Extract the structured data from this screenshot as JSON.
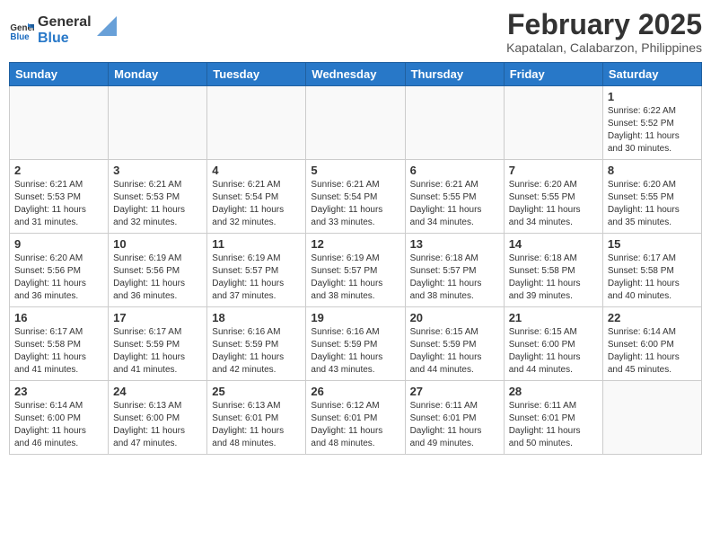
{
  "header": {
    "logo_line1": "General",
    "logo_line2": "Blue",
    "month_year": "February 2025",
    "location": "Kapatalan, Calabarzon, Philippines"
  },
  "weekdays": [
    "Sunday",
    "Monday",
    "Tuesday",
    "Wednesday",
    "Thursday",
    "Friday",
    "Saturday"
  ],
  "weeks": [
    [
      {
        "day": "",
        "info": ""
      },
      {
        "day": "",
        "info": ""
      },
      {
        "day": "",
        "info": ""
      },
      {
        "day": "",
        "info": ""
      },
      {
        "day": "",
        "info": ""
      },
      {
        "day": "",
        "info": ""
      },
      {
        "day": "1",
        "info": "Sunrise: 6:22 AM\nSunset: 5:52 PM\nDaylight: 11 hours\nand 30 minutes."
      }
    ],
    [
      {
        "day": "2",
        "info": "Sunrise: 6:21 AM\nSunset: 5:53 PM\nDaylight: 11 hours\nand 31 minutes."
      },
      {
        "day": "3",
        "info": "Sunrise: 6:21 AM\nSunset: 5:53 PM\nDaylight: 11 hours\nand 32 minutes."
      },
      {
        "day": "4",
        "info": "Sunrise: 6:21 AM\nSunset: 5:54 PM\nDaylight: 11 hours\nand 32 minutes."
      },
      {
        "day": "5",
        "info": "Sunrise: 6:21 AM\nSunset: 5:54 PM\nDaylight: 11 hours\nand 33 minutes."
      },
      {
        "day": "6",
        "info": "Sunrise: 6:21 AM\nSunset: 5:55 PM\nDaylight: 11 hours\nand 34 minutes."
      },
      {
        "day": "7",
        "info": "Sunrise: 6:20 AM\nSunset: 5:55 PM\nDaylight: 11 hours\nand 34 minutes."
      },
      {
        "day": "8",
        "info": "Sunrise: 6:20 AM\nSunset: 5:55 PM\nDaylight: 11 hours\nand 35 minutes."
      }
    ],
    [
      {
        "day": "9",
        "info": "Sunrise: 6:20 AM\nSunset: 5:56 PM\nDaylight: 11 hours\nand 36 minutes."
      },
      {
        "day": "10",
        "info": "Sunrise: 6:19 AM\nSunset: 5:56 PM\nDaylight: 11 hours\nand 36 minutes."
      },
      {
        "day": "11",
        "info": "Sunrise: 6:19 AM\nSunset: 5:57 PM\nDaylight: 11 hours\nand 37 minutes."
      },
      {
        "day": "12",
        "info": "Sunrise: 6:19 AM\nSunset: 5:57 PM\nDaylight: 11 hours\nand 38 minutes."
      },
      {
        "day": "13",
        "info": "Sunrise: 6:18 AM\nSunset: 5:57 PM\nDaylight: 11 hours\nand 38 minutes."
      },
      {
        "day": "14",
        "info": "Sunrise: 6:18 AM\nSunset: 5:58 PM\nDaylight: 11 hours\nand 39 minutes."
      },
      {
        "day": "15",
        "info": "Sunrise: 6:17 AM\nSunset: 5:58 PM\nDaylight: 11 hours\nand 40 minutes."
      }
    ],
    [
      {
        "day": "16",
        "info": "Sunrise: 6:17 AM\nSunset: 5:58 PM\nDaylight: 11 hours\nand 41 minutes."
      },
      {
        "day": "17",
        "info": "Sunrise: 6:17 AM\nSunset: 5:59 PM\nDaylight: 11 hours\nand 41 minutes."
      },
      {
        "day": "18",
        "info": "Sunrise: 6:16 AM\nSunset: 5:59 PM\nDaylight: 11 hours\nand 42 minutes."
      },
      {
        "day": "19",
        "info": "Sunrise: 6:16 AM\nSunset: 5:59 PM\nDaylight: 11 hours\nand 43 minutes."
      },
      {
        "day": "20",
        "info": "Sunrise: 6:15 AM\nSunset: 5:59 PM\nDaylight: 11 hours\nand 44 minutes."
      },
      {
        "day": "21",
        "info": "Sunrise: 6:15 AM\nSunset: 6:00 PM\nDaylight: 11 hours\nand 44 minutes."
      },
      {
        "day": "22",
        "info": "Sunrise: 6:14 AM\nSunset: 6:00 PM\nDaylight: 11 hours\nand 45 minutes."
      }
    ],
    [
      {
        "day": "23",
        "info": "Sunrise: 6:14 AM\nSunset: 6:00 PM\nDaylight: 11 hours\nand 46 minutes."
      },
      {
        "day": "24",
        "info": "Sunrise: 6:13 AM\nSunset: 6:00 PM\nDaylight: 11 hours\nand 47 minutes."
      },
      {
        "day": "25",
        "info": "Sunrise: 6:13 AM\nSunset: 6:01 PM\nDaylight: 11 hours\nand 48 minutes."
      },
      {
        "day": "26",
        "info": "Sunrise: 6:12 AM\nSunset: 6:01 PM\nDaylight: 11 hours\nand 48 minutes."
      },
      {
        "day": "27",
        "info": "Sunrise: 6:11 AM\nSunset: 6:01 PM\nDaylight: 11 hours\nand 49 minutes."
      },
      {
        "day": "28",
        "info": "Sunrise: 6:11 AM\nSunset: 6:01 PM\nDaylight: 11 hours\nand 50 minutes."
      },
      {
        "day": "",
        "info": ""
      }
    ]
  ]
}
